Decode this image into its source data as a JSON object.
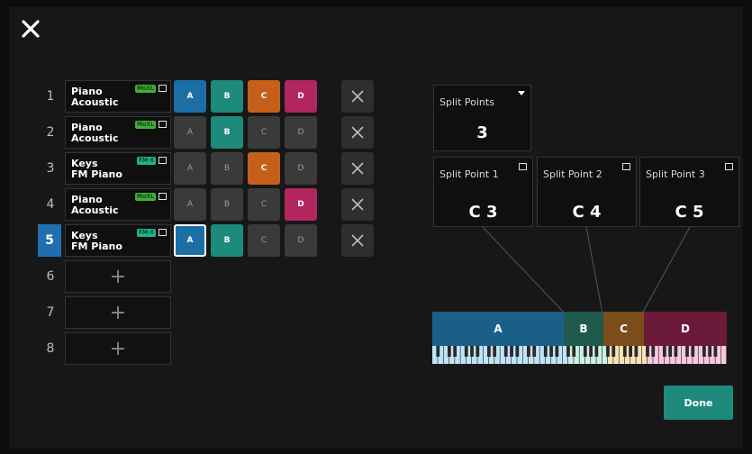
{
  "close_icon": "close-icon",
  "parts": [
    {
      "num": "1",
      "line1": "Piano",
      "line2": "Acoustic",
      "badge": "MoXL",
      "zones": [
        "A",
        "B",
        "C",
        "D"
      ],
      "active": [
        true,
        true,
        true,
        true
      ]
    },
    {
      "num": "2",
      "line1": "Piano",
      "line2": "Acoustic",
      "badge": "MoXL",
      "zones": [
        "A",
        "B",
        "C",
        "D"
      ],
      "active": [
        false,
        true,
        false,
        false
      ]
    },
    {
      "num": "3",
      "line1": "Keys",
      "line2": "FM Piano",
      "badge": "FM-X",
      "zones": [
        "A",
        "B",
        "C",
        "D"
      ],
      "active": [
        false,
        false,
        true,
        false
      ]
    },
    {
      "num": "4",
      "line1": "Piano",
      "line2": "Acoustic",
      "badge": "MoXL",
      "zones": [
        "A",
        "B",
        "C",
        "D"
      ],
      "active": [
        false,
        false,
        false,
        true
      ]
    },
    {
      "num": "5",
      "line1": "Keys",
      "line2": "FM Piano",
      "badge": "FM-X",
      "zones": [
        "A",
        "B",
        "C",
        "D"
      ],
      "active": [
        true,
        true,
        false,
        false
      ]
    }
  ],
  "empty_parts": [
    "6",
    "7",
    "8"
  ],
  "add_symbol": "+",
  "split_points": {
    "label": "Split Points",
    "value": "3"
  },
  "split_point_boxes": [
    {
      "label": "Split Point 1",
      "value": "C 3"
    },
    {
      "label": "Split Point 2",
      "value": "C 4"
    },
    {
      "label": "Split Point 3",
      "value": "C 5"
    }
  ],
  "keyboard_zones": [
    {
      "label": "A",
      "color": "#1b5f86"
    },
    {
      "label": "B",
      "color": "#1f5a4d"
    },
    {
      "label": "C",
      "color": "#7a4d1a"
    },
    {
      "label": "D",
      "color": "#6b1a3a"
    }
  ],
  "done_label": "Done",
  "colors": {
    "zone_a": "#1b6fa5",
    "zone_b": "#1e8a7c",
    "zone_c": "#c5601a",
    "zone_d": "#b1265f",
    "selected_part": "#1f6fb0"
  }
}
